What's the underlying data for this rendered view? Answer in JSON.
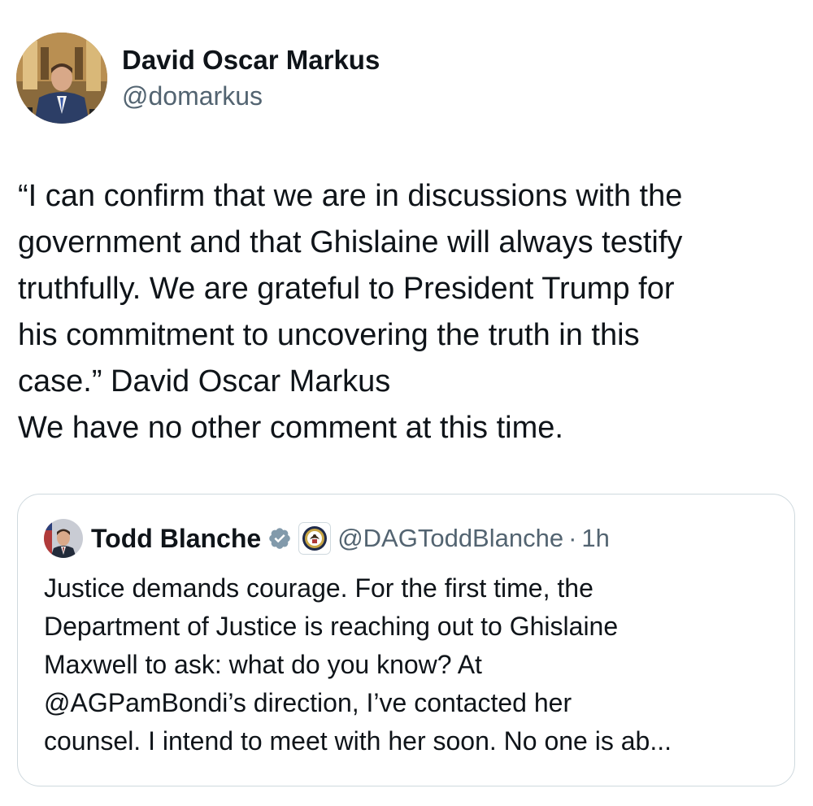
{
  "tweet": {
    "author": {
      "display_name": "David Oscar Markus",
      "handle": "@domarkus",
      "avatar_icon": "profile-photo"
    },
    "text_lines": [
      "“I can confirm that we are in discussions with the",
      "government and that Ghislaine will always testify",
      "truthfully. We are grateful to President Trump for",
      "his commitment to uncovering the truth in this",
      "case.” David Oscar Markus",
      "We have no other comment at this time."
    ]
  },
  "quoted_tweet": {
    "author": {
      "display_name": "Todd Blanche",
      "handle": "@DAGToddBlanche",
      "separator": "·",
      "time": "1h",
      "verified_icon": "verified-badge-icon",
      "affiliation_icon": "doj-seal-icon"
    },
    "text_lines": [
      "Justice demands courage. For the first time, the",
      "Department of Justice is reaching out to Ghislaine",
      "Maxwell to ask: what do you know? At",
      "@AGPamBondi’s direction, I’ve contacted her",
      "counsel. I intend to meet with her soon. No one is ab..."
    ]
  },
  "colors": {
    "text_primary": "#0f1419",
    "text_secondary": "#536471",
    "card_border": "#cfd9de",
    "verified_badge": "#829aab"
  }
}
